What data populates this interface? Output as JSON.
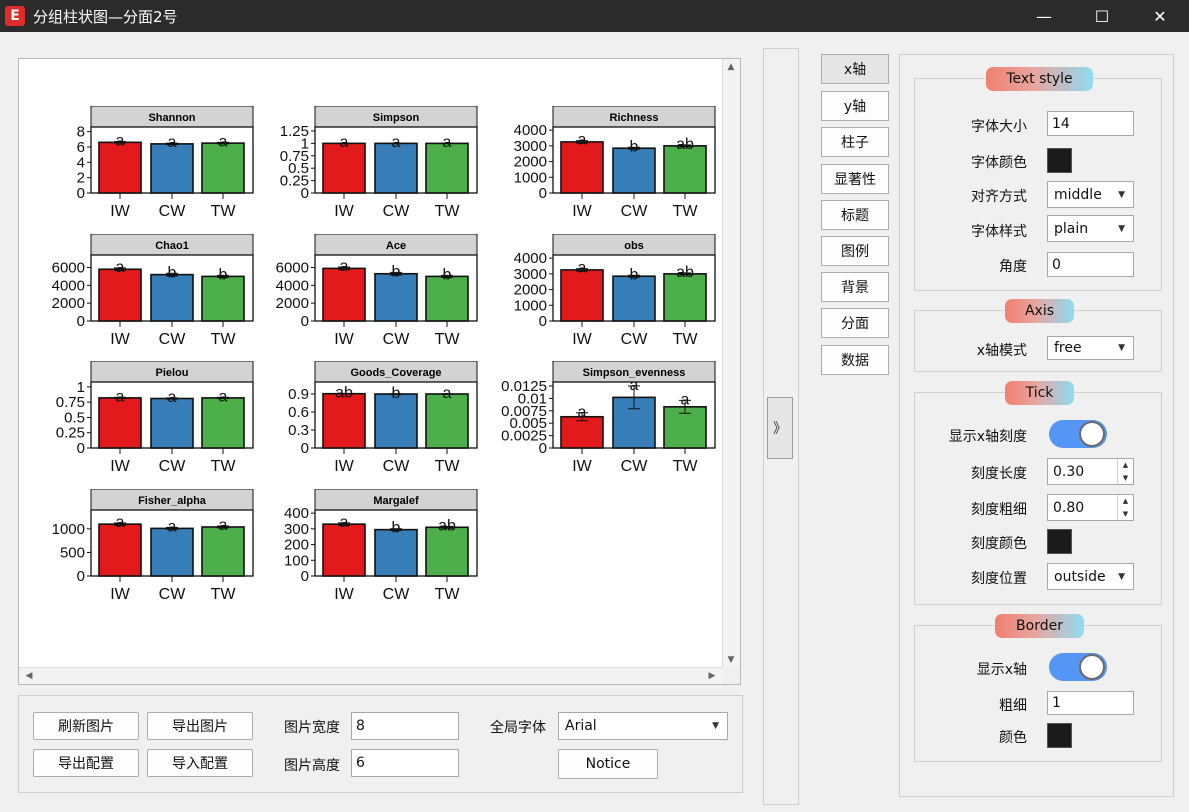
{
  "window": {
    "logo": "E",
    "title": "分组柱状图—分面2号",
    "minimize": "—",
    "maximize": "☐",
    "close": "✕"
  },
  "colors": {
    "IW": "#e31a1c",
    "CW": "#377eb8",
    "TW": "#4daf4a",
    "strip": "#d3d3d3"
  },
  "chart_data": {
    "type": "bar",
    "categories": [
      "IW",
      "CW",
      "TW"
    ],
    "facets": [
      {
        "title": "Shannon",
        "ticks": [
          "8",
          "6",
          "4",
          "2",
          "0"
        ],
        "tick_values": [
          8,
          6,
          4,
          2,
          0
        ],
        "ymax": 8.6,
        "values": [
          6.6,
          6.4,
          6.5
        ],
        "labels": [
          "a",
          "a",
          "a"
        ],
        "err": [
          0.1,
          0.1,
          0.1
        ]
      },
      {
        "title": "Simpson",
        "ticks": [
          "1.25",
          "1",
          "0.75",
          "0.5",
          "0.25",
          "0"
        ],
        "tick_values": [
          1.25,
          1,
          0.75,
          0.5,
          0.25,
          0
        ],
        "ymax": 1.33,
        "values": [
          1.0,
          1.0,
          1.0
        ],
        "labels": [
          "a",
          "a",
          "a"
        ],
        "err": [
          0.005,
          0.005,
          0.005
        ]
      },
      {
        "title": "Richness",
        "ticks": [
          "4000",
          "3000",
          "2000",
          "1000",
          "0"
        ],
        "tick_values": [
          4000,
          3000,
          2000,
          1000,
          0
        ],
        "ymax": 4200,
        "values": [
          3250,
          2850,
          3000
        ],
        "labels": [
          "a",
          "b",
          "ab"
        ],
        "err": [
          80,
          60,
          60
        ]
      },
      {
        "title": "Chao1",
        "ticks": [
          "6000",
          "4000",
          "2000",
          "0"
        ],
        "tick_values": [
          6000,
          4000,
          2000,
          0
        ],
        "ymax": 7400,
        "values": [
          5800,
          5200,
          5000
        ],
        "labels": [
          "a",
          "b",
          "b"
        ],
        "err": [
          150,
          150,
          120
        ]
      },
      {
        "title": "Ace",
        "ticks": [
          "6000",
          "4000",
          "2000",
          "0"
        ],
        "tick_values": [
          6000,
          4000,
          2000,
          0
        ],
        "ymax": 7400,
        "values": [
          5900,
          5300,
          5000
        ],
        "labels": [
          "a",
          "b",
          "b"
        ],
        "err": [
          150,
          150,
          120
        ]
      },
      {
        "title": "obs",
        "ticks": [
          "4000",
          "3000",
          "2000",
          "1000",
          "0"
        ],
        "tick_values": [
          4000,
          3000,
          2000,
          1000,
          0
        ],
        "ymax": 4200,
        "values": [
          3250,
          2850,
          3000
        ],
        "labels": [
          "a",
          "b",
          "ab"
        ],
        "err": [
          80,
          60,
          60
        ]
      },
      {
        "title": "Pielou",
        "ticks": [
          "1",
          "0.75",
          "0.5",
          "0.25",
          "0"
        ],
        "tick_values": [
          1,
          0.75,
          0.5,
          0.25,
          0
        ],
        "ymax": 1.08,
        "values": [
          0.82,
          0.81,
          0.82
        ],
        "labels": [
          "a",
          "a",
          "a"
        ],
        "err": [
          0.01,
          0.01,
          0.01
        ]
      },
      {
        "title": "Goods_Coverage",
        "ticks": [
          "0.9",
          "0.6",
          "0.3",
          "0"
        ],
        "tick_values": [
          0.9,
          0.6,
          0.3,
          0
        ],
        "ymax": 1.1,
        "values": [
          0.905,
          0.9,
          0.9
        ],
        "labels": [
          "ab",
          "b",
          "a"
        ],
        "err": [
          0.004,
          0.004,
          0.004
        ]
      },
      {
        "title": "Simpson_evenness",
        "ticks": [
          "0.0125",
          "0.01",
          "0.0075",
          "0.005",
          "0.0025",
          "0"
        ],
        "tick_values": [
          0.0125,
          0.01,
          0.0075,
          0.005,
          0.0025,
          0
        ],
        "ymax": 0.0133,
        "values": [
          0.0063,
          0.0102,
          0.0083
        ],
        "labels": [
          "a",
          "a",
          "a"
        ],
        "err": [
          0.0008,
          0.0023,
          0.0013
        ]
      },
      {
        "title": "Fisher_alpha",
        "ticks": [
          "1000",
          "500",
          "0"
        ],
        "tick_values": [
          1000,
          500,
          0
        ],
        "ymax": 1400,
        "values": [
          1100,
          1010,
          1040
        ],
        "labels": [
          "a",
          "a",
          "a"
        ],
        "err": [
          25,
          20,
          20
        ]
      },
      {
        "title": "Margalef",
        "ticks": [
          "400",
          "300",
          "200",
          "100",
          "0"
        ],
        "tick_values": [
          400,
          300,
          200,
          100,
          0
        ],
        "ymax": 420,
        "values": [
          330,
          295,
          310
        ],
        "labels": [
          "a",
          "b",
          "ab"
        ],
        "err": [
          8,
          6,
          6
        ]
      }
    ]
  },
  "bottom": {
    "refresh": "刷新图片",
    "export_image": "导出图片",
    "export_config": "导出配置",
    "import_config": "导入配置",
    "width_label": "图片宽度",
    "width_value": "8",
    "height_label": "图片高度",
    "height_value": "6",
    "font_label": "全局字体",
    "font_value": "Arial",
    "notice": "Notice"
  },
  "collapse": "》",
  "tabs": [
    "x轴",
    "y轴",
    "柱子",
    "显著性",
    "标题",
    "图例",
    "背景",
    "分面",
    "数据"
  ],
  "settings": {
    "text_style": {
      "title": "Text style",
      "size_label": "字体大小",
      "size_value": "14",
      "color_label": "字体颜色",
      "align_label": "对齐方式",
      "align_value": "middle",
      "style_label": "字体样式",
      "style_value": "plain",
      "angle_label": "角度",
      "angle_value": "0"
    },
    "axis": {
      "title": "Axis",
      "mode_label": "x轴模式",
      "mode_value": "free"
    },
    "tick": {
      "title": "Tick",
      "show_label": "显示x轴刻度",
      "length_label": "刻度长度",
      "length_value": "0.30",
      "width_label": "刻度粗细",
      "width_value": "0.80",
      "color_label": "刻度颜色",
      "position_label": "刻度位置",
      "position_value": "outside"
    },
    "border": {
      "title": "Border",
      "show_label": "显示x轴",
      "width_label": "粗细",
      "width_value": "1",
      "color_label": "颜色"
    }
  }
}
